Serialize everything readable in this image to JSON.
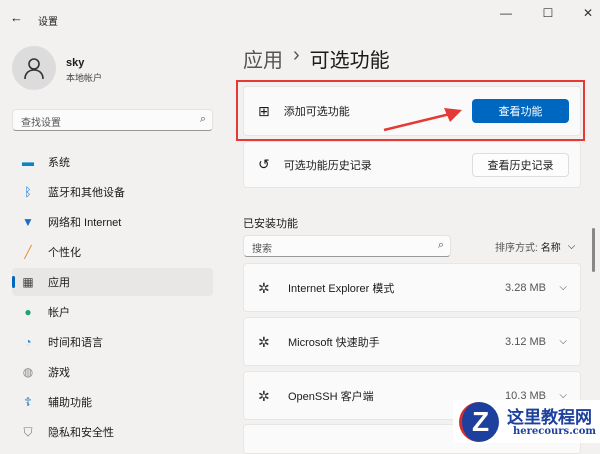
{
  "window": {
    "title": "设置",
    "back_icon": "arrow-left-icon",
    "minimize": "—",
    "maximize": "☐",
    "close": "✕"
  },
  "user": {
    "name": "sky",
    "account_type": "本地帐户"
  },
  "search": {
    "placeholder": "查找设置"
  },
  "nav": [
    {
      "label": "系统",
      "icon": "monitor-icon",
      "color": "#0a84c6"
    },
    {
      "label": "蓝牙和其他设备",
      "icon": "bluetooth-icon",
      "color": "#0a78d4"
    },
    {
      "label": "网络和 Internet",
      "icon": "wifi-icon",
      "color": "#1a6fc4"
    },
    {
      "label": "个性化",
      "icon": "brush-icon",
      "color": "#e08a2e"
    },
    {
      "label": "应用",
      "icon": "apps-icon",
      "color": "#444"
    },
    {
      "label": "帐户",
      "icon": "person-icon",
      "color": "#1aa37a"
    },
    {
      "label": "时间和语言",
      "icon": "clock-globe-icon",
      "color": "#2a8ad4"
    },
    {
      "label": "游戏",
      "icon": "gamepad-icon",
      "color": "#888"
    },
    {
      "label": "辅助功能",
      "icon": "accessibility-icon",
      "color": "#1a6fc4"
    },
    {
      "label": "隐私和安全性",
      "icon": "shield-icon",
      "color": "#777"
    }
  ],
  "breadcrumb": {
    "parent": "应用",
    "separator": "›",
    "current": "可选功能"
  },
  "add_feature": {
    "label": "添加可选功能",
    "button": "查看功能"
  },
  "history": {
    "label": "可选功能历史记录",
    "button": "查看历史记录"
  },
  "installed": {
    "heading": "已安装功能",
    "search_placeholder": "搜索",
    "sort_label": "排序方式:",
    "sort_value": "名称",
    "items": [
      {
        "name": "Internet Explorer 模式",
        "size": "3.28 MB"
      },
      {
        "name": "Microsoft 快速助手",
        "size": "3.12 MB"
      },
      {
        "name": "OpenSSH 客户端",
        "size": "10.3 MB"
      }
    ]
  },
  "watermark": {
    "title": "这里教程网",
    "url": "herecours.com"
  },
  "colors": {
    "accent": "#0067c0",
    "highlight": "#e53935"
  }
}
